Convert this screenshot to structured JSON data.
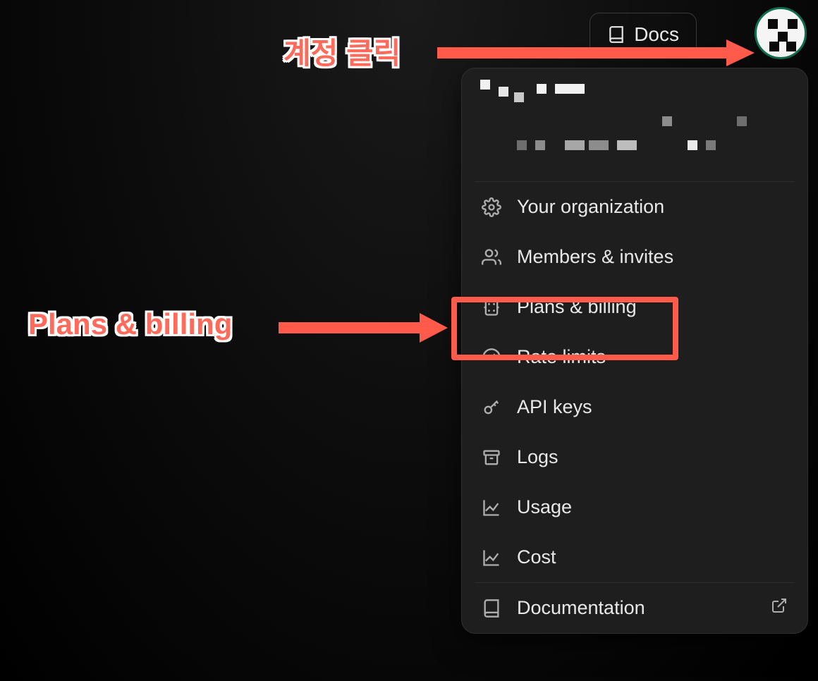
{
  "navbar": {
    "docs_label": "Docs"
  },
  "menu": {
    "items": [
      {
        "label": "Your organization",
        "icon": "gear-icon"
      },
      {
        "label": "Members & invites",
        "icon": "users-icon"
      },
      {
        "label": "Plans & billing",
        "icon": "billing-icon"
      },
      {
        "label": "Rate limits",
        "icon": "gauge-icon"
      },
      {
        "label": "API keys",
        "icon": "key-icon"
      },
      {
        "label": "Logs",
        "icon": "archive-icon"
      },
      {
        "label": "Usage",
        "icon": "chart-icon"
      },
      {
        "label": "Cost",
        "icon": "chart-icon"
      }
    ],
    "footer_label": "Documentation",
    "footer_icon": "book-icon"
  },
  "annotations": {
    "click_account": "계정 클릭",
    "plans_billing": "Plans & billing"
  }
}
